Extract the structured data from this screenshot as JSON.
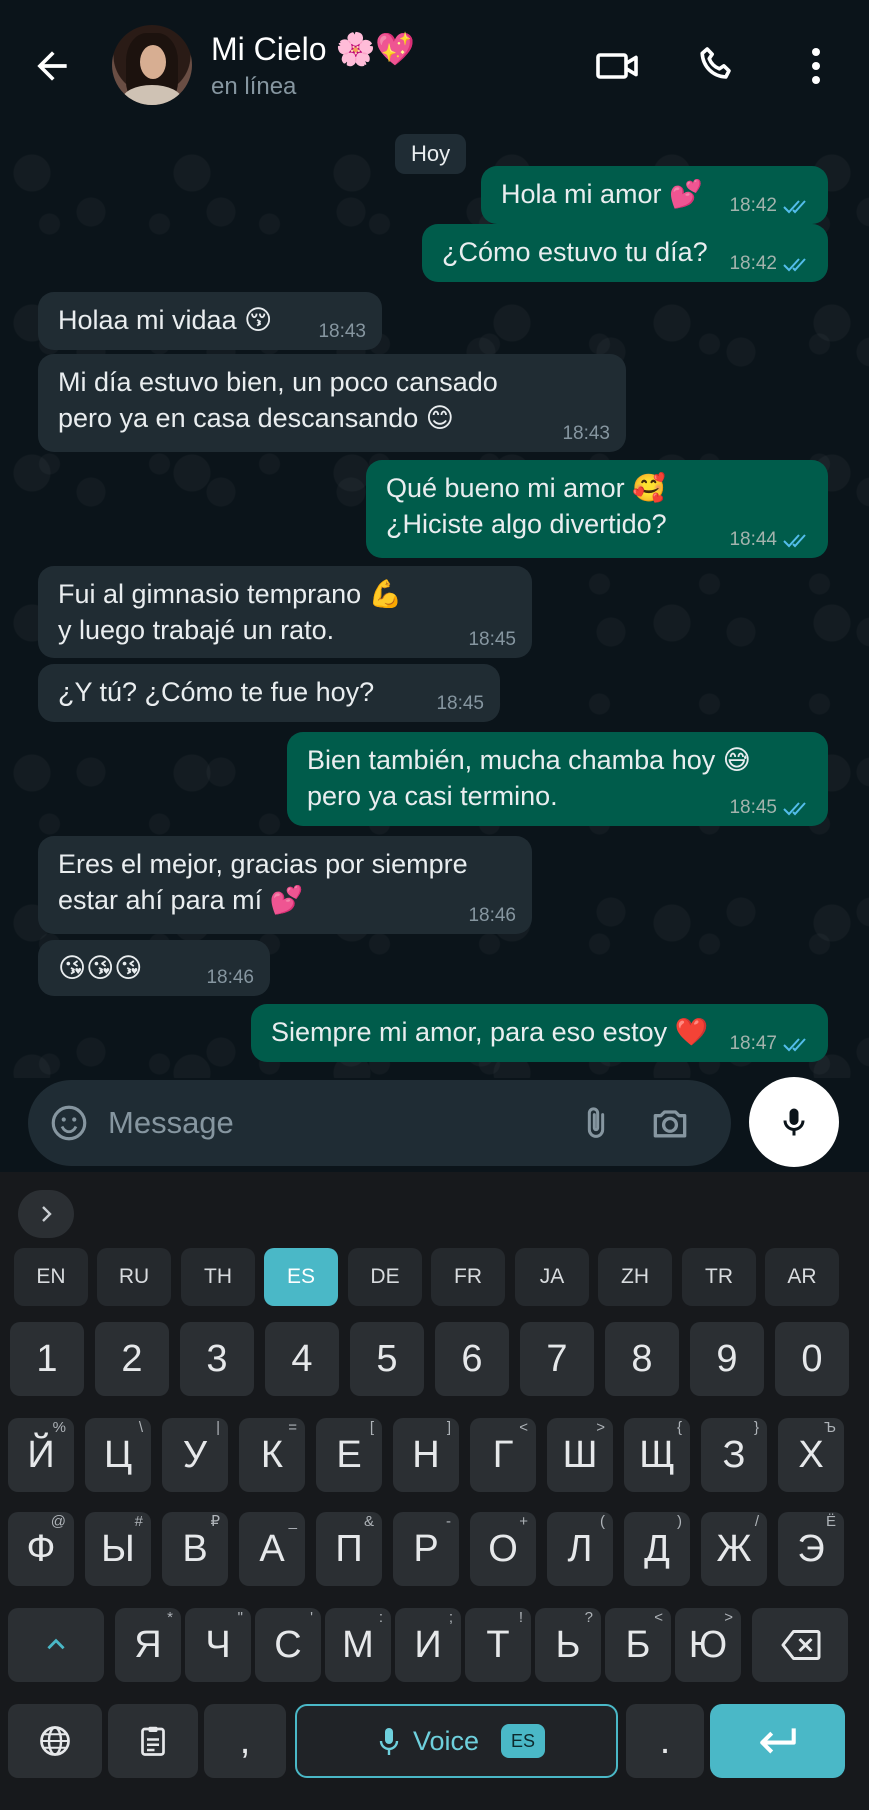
{
  "header": {
    "contact_name": "Mi Cielo 🌸💖",
    "status": "en línea"
  },
  "chat": {
    "date_chip": "Hoy",
    "messages": [
      {
        "dir": "out",
        "text": "Hola mi amor 💕",
        "time": "18:42",
        "read": true
      },
      {
        "dir": "out",
        "text": "¿Cómo estuvo tu día?",
        "time": "18:42",
        "read": true
      },
      {
        "dir": "in",
        "text": "Holaa mi vidaa 😚",
        "time": "18:43"
      },
      {
        "dir": "in",
        "text": "Mi día estuvo bien, un poco cansado\npero ya en casa descansando 😊",
        "time": "18:43"
      },
      {
        "dir": "out",
        "text": "Qué bueno mi amor 🥰\n¿Hiciste algo divertido?",
        "time": "18:44",
        "read": true
      },
      {
        "dir": "in",
        "text": "Fui al gimnasio temprano 💪\ny luego trabajé un rato.",
        "time": "18:45"
      },
      {
        "dir": "in",
        "text": "¿Y tú? ¿Cómo te fue hoy?",
        "time": "18:45"
      },
      {
        "dir": "out",
        "text": "Bien también, mucha chamba hoy 😅\npero ya casi termino.",
        "time": "18:45",
        "read": true
      },
      {
        "dir": "in",
        "text": "Eres el mejor, gracias por siempre\nestar ahí para mí 💕",
        "time": "18:46"
      },
      {
        "dir": "in",
        "text": "😘😘😘",
        "time": "18:46"
      },
      {
        "dir": "out",
        "text": "Siempre mi amor, para eso estoy ❤️",
        "time": "18:47",
        "read": true
      }
    ]
  },
  "composer": {
    "placeholder": "Message",
    "icons": [
      "emoji-icon",
      "attach-icon",
      "camera-icon",
      "mic-icon"
    ]
  },
  "keyboard": {
    "languages": [
      "EN",
      "RU",
      "TH",
      "ES",
      "DE",
      "FR",
      "JA",
      "ZH",
      "TR",
      "AR"
    ],
    "active_language": "ES",
    "number_row": [
      "1",
      "2",
      "3",
      "4",
      "5",
      "6",
      "7",
      "8",
      "9",
      "0"
    ],
    "row1": [
      [
        "Й",
        "%"
      ],
      [
        "Ц",
        "\\"
      ],
      [
        "У",
        "|"
      ],
      [
        "К",
        "="
      ],
      [
        "Е",
        "["
      ],
      [
        "Н",
        "]"
      ],
      [
        "Г",
        "<"
      ],
      [
        "Ш",
        ">"
      ],
      [
        "Щ",
        "{"
      ],
      [
        "З",
        "}"
      ],
      [
        "Х",
        "Ъ"
      ]
    ],
    "row2": [
      [
        "Ф",
        "@"
      ],
      [
        "Ы",
        "#"
      ],
      [
        "В",
        "₽"
      ],
      [
        "А",
        "_"
      ],
      [
        "П",
        "&"
      ],
      [
        "Р",
        "-"
      ],
      [
        "О",
        "+"
      ],
      [
        "Л",
        "("
      ],
      [
        "Д",
        ")"
      ],
      [
        "Ж",
        "/"
      ],
      [
        "Э",
        "Ё"
      ]
    ],
    "row3": [
      [
        "Я",
        "*"
      ],
      [
        "Ч",
        "\""
      ],
      [
        "С",
        "'"
      ],
      [
        "М",
        ":"
      ],
      [
        "И",
        ";"
      ],
      [
        "Т",
        "!"
      ],
      [
        "Ь",
        "?"
      ],
      [
        "Б",
        "<"
      ],
      [
        "Ю",
        ">"
      ]
    ],
    "comma": ",",
    "period": ".",
    "voice_label": "Voice",
    "voice_badge": "ES"
  },
  "colors": {
    "outgoing_bubble": "#005c4b",
    "incoming_bubble": "#202c33",
    "accent": "#4ab8c7",
    "read_ticks": "#53bdeb"
  }
}
